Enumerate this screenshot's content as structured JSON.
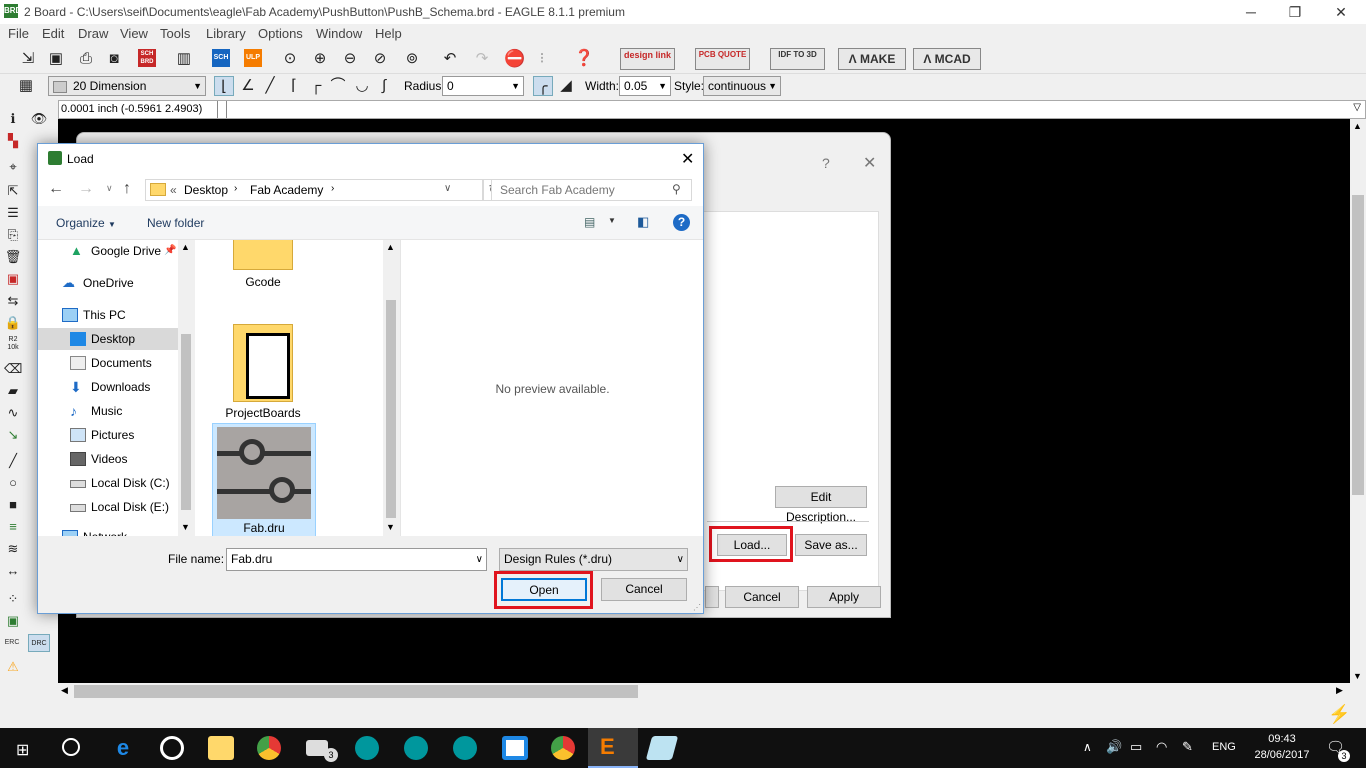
{
  "window": {
    "title": "2 Board - C:\\Users\\seif\\Documents\\eagle\\Fab Academy\\PushButton\\PushB_Schema.brd - EAGLE 8.1.1 premium",
    "app_icon": "BRD"
  },
  "menu": [
    "File",
    "Edit",
    "Draw",
    "View",
    "Tools",
    "Library",
    "Options",
    "Window",
    "Help"
  ],
  "toolbar_buttons": {
    "design_link": "design link",
    "pcb_quote": "PCB QUOTE",
    "idf": "IDF TO 3D",
    "make": "MAKE",
    "mcad": "MCAD",
    "sch": "SCH",
    "brd": "BRD",
    "ulp": "ULP"
  },
  "toolbar2": {
    "layer": "20 Dimension",
    "radius_label": "Radius:",
    "radius_value": "0",
    "width_label": "Width:",
    "width_value": "0.05",
    "style_label": "Style:",
    "style_value": "continuous"
  },
  "coord": "0.0001 inch (-0.5961 2.4903)",
  "left_toolbar": {
    "r2": "R2",
    "r2val": "10k",
    "erc": "ERC",
    "drc": "DRC"
  },
  "drc_dialog": {
    "help": "?",
    "edit_description": "Edit Description...",
    "load": "Load...",
    "save_as": "Save as...",
    "cancel": "Cancel",
    "apply": "Apply"
  },
  "load_dialog": {
    "title": "Load",
    "breadcrumb": [
      "Desktop",
      "Fab Academy"
    ],
    "breadcrumb_prefix": "«",
    "search_placeholder": "Search Fab Academy",
    "organize": "Organize",
    "new_folder": "New folder",
    "nav": [
      {
        "label": "Google Drive",
        "icon": "google-drive-icon"
      },
      {
        "label": "OneDrive",
        "icon": "onedrive-icon"
      },
      {
        "label": "This PC",
        "icon": "computer-icon"
      },
      {
        "label": "Desktop",
        "icon": "desktop-icon"
      },
      {
        "label": "Documents",
        "icon": "documents-icon"
      },
      {
        "label": "Downloads",
        "icon": "downloads-icon"
      },
      {
        "label": "Music",
        "icon": "music-icon"
      },
      {
        "label": "Pictures",
        "icon": "pictures-icon"
      },
      {
        "label": "Videos",
        "icon": "videos-icon"
      },
      {
        "label": "Local Disk (C:)",
        "icon": "disk-icon"
      },
      {
        "label": "Local Disk (E:)",
        "icon": "disk-icon"
      },
      {
        "label": "Network",
        "icon": "network-icon"
      }
    ],
    "files": [
      {
        "name": "Gcode",
        "icon": "folder-icon"
      },
      {
        "name": "ProjectBoards",
        "icon": "folder-icon"
      },
      {
        "name": "Fab.dru",
        "icon": "settings-file-icon",
        "selected": true
      }
    ],
    "preview": "No preview available.",
    "file_name_label": "File name:",
    "file_name_value": "Fab.dru",
    "file_type": "Design Rules (*.dru)",
    "open": "Open",
    "cancel": "Cancel"
  },
  "taskbar": {
    "time": "09:43",
    "date": "28/06/2017",
    "lang": "ENG",
    "mail_badge": "3",
    "notif_badge": "3"
  },
  "colors": {
    "highlight_red": "#e0141e",
    "selection_blue": "#cce8ff",
    "canvas_black": "#000000",
    "taskbar": "#101010"
  }
}
